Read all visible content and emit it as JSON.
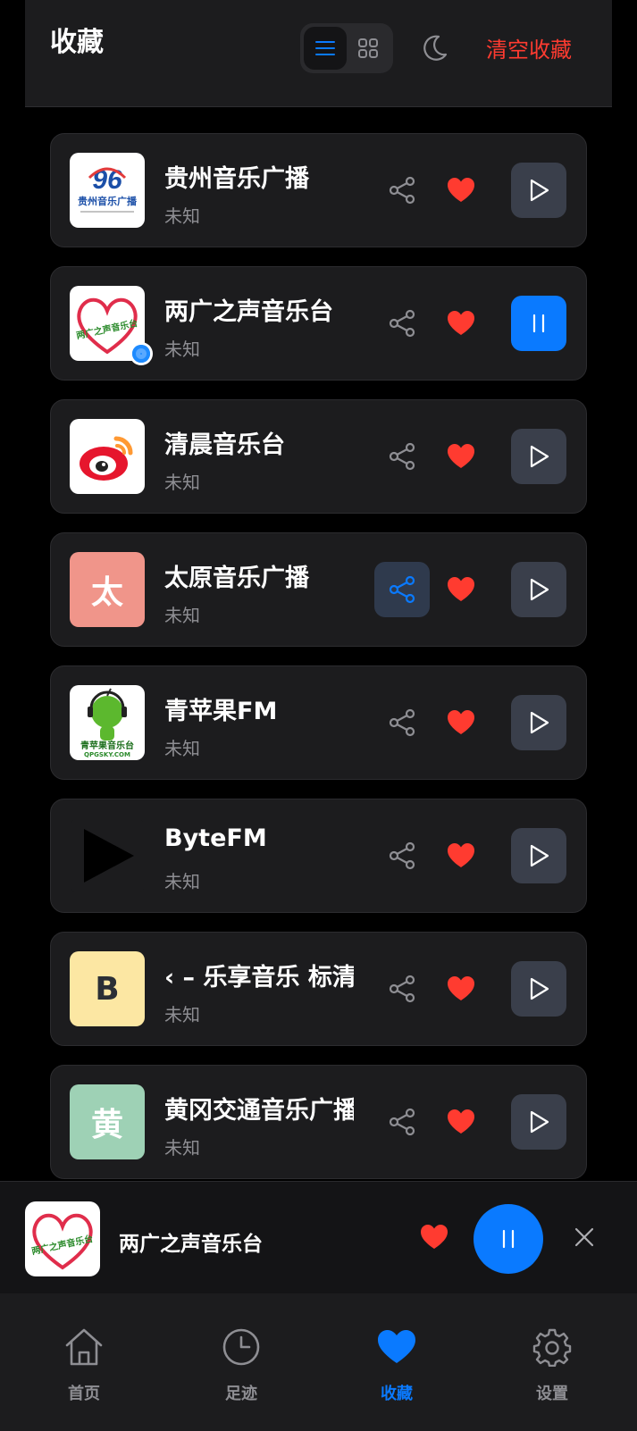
{
  "header": {
    "title": "收藏",
    "clear_label": "清空收藏"
  },
  "stations": [
    {
      "name": "贵州音乐广播",
      "subtitle": "未知",
      "logo_text": "",
      "logo_bg": "#ffffff",
      "playing": false,
      "share_active": false
    },
    {
      "name": "两广之声音乐台",
      "subtitle": "未知",
      "logo_text": "",
      "logo_bg": "#ffffff",
      "playing": true,
      "share_active": false
    },
    {
      "name": "清晨音乐台",
      "subtitle": "未知",
      "logo_text": "",
      "logo_bg": "#ffffff",
      "playing": false,
      "share_active": false
    },
    {
      "name": "太原音乐广播",
      "subtitle": "未知",
      "logo_text": "太",
      "logo_bg": "#f0958a",
      "playing": false,
      "share_active": true
    },
    {
      "name": "青苹果FM",
      "subtitle": "未知",
      "logo_text": "",
      "logo_bg": "#ffffff",
      "playing": false,
      "share_active": false
    },
    {
      "name": "ByteFM",
      "subtitle": "未知",
      "logo_text": "",
      "logo_bg": "#1c1c1e",
      "playing": false,
      "share_active": false
    },
    {
      "name": "‹ – 乐享音乐 标清",
      "subtitle": "未知",
      "logo_text": "B",
      "logo_bg": "#fce7a3",
      "playing": false,
      "share_active": false
    },
    {
      "name": "黄冈交通音乐广播",
      "subtitle": "未知",
      "logo_text": "黄",
      "logo_bg": "#9ed1b5",
      "playing": false,
      "share_active": false
    }
  ],
  "logo_marks": {
    "guizhou_number": "96",
    "guizhou_caption": "贵州音乐广播",
    "lianguang_caption": "两广之声音乐台",
    "qingpingguo_caption": "青苹果音乐台",
    "qingpingguo_site": "QPGSKY.COM"
  },
  "player": {
    "name": "两广之声音乐台"
  },
  "tabs": [
    {
      "label": "首页",
      "icon": "home-icon"
    },
    {
      "label": "足迹",
      "icon": "clock-icon"
    },
    {
      "label": "收藏",
      "icon": "heart-icon"
    },
    {
      "label": "设置",
      "icon": "gear-icon"
    }
  ],
  "colors": {
    "accent": "#0a7aff",
    "favorite": "#ff3b30",
    "card_bg": "#1c1c1e",
    "button_bg": "#3a3f4b"
  }
}
